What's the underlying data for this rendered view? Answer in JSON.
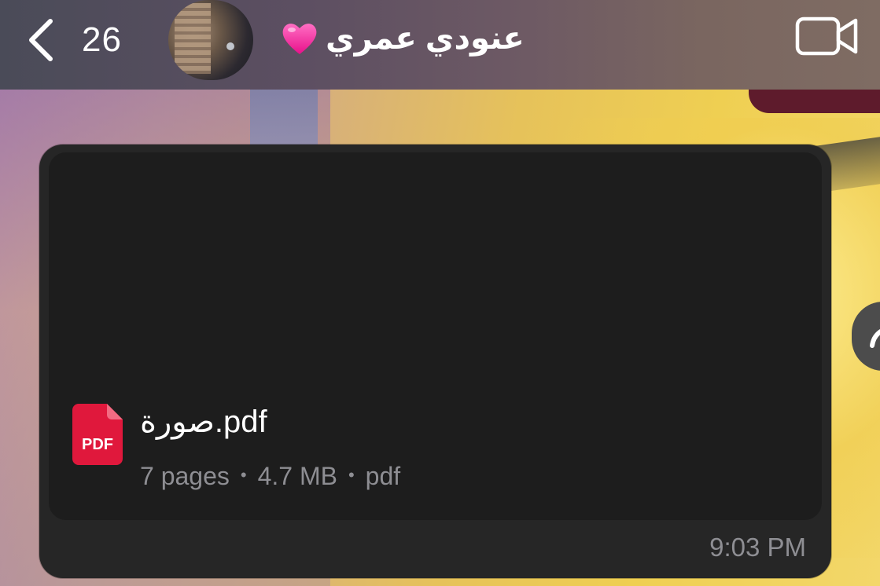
{
  "header": {
    "unread_count": "26",
    "contact_name": "عنودي عمري",
    "heart_emoji": "pink-heart-icon",
    "icons": {
      "back": "chevron-left-icon",
      "video_call": "video-camera-icon"
    }
  },
  "message": {
    "file": {
      "name": "صورة.pdf",
      "icon": "pdf-file-icon",
      "icon_label": "PDF",
      "pages": "7 pages",
      "size": "4.7 MB",
      "type": "pdf"
    },
    "time": "9:03 PM"
  },
  "colors": {
    "bubble": "#262626",
    "file_card": "#1d1d1d",
    "pdf_red": "#e0183c",
    "meta_text": "#8e8e93",
    "prev_bubble": "#5e1b2c",
    "heart": "#ff3ea5"
  }
}
